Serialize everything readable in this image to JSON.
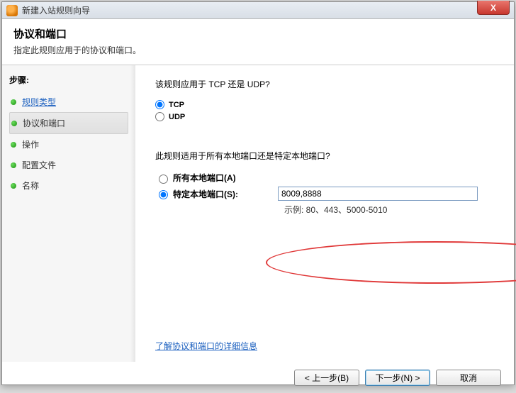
{
  "window": {
    "title": "新建入站规则向导",
    "close": "X"
  },
  "header": {
    "title": "协议和端口",
    "subtitle": "指定此规则应用于的协议和端口。"
  },
  "sidebar": {
    "steps_label": "步骤:",
    "items": [
      {
        "label": "规则类型",
        "state": "completed"
      },
      {
        "label": "协议和端口",
        "state": "current"
      },
      {
        "label": "操作",
        "state": "pending"
      },
      {
        "label": "配置文件",
        "state": "pending"
      },
      {
        "label": "名称",
        "state": "pending"
      }
    ]
  },
  "content": {
    "protocol_question": "该规则应用于 TCP 还是 UDP?",
    "protocol": {
      "tcp": "TCP",
      "udp": "UDP",
      "selected": "tcp"
    },
    "port_question": "此规则适用于所有本地端口还是特定本地端口?",
    "ports": {
      "all_label": "所有本地端口(A)",
      "specific_label": "特定本地端口(S):",
      "selected": "specific",
      "value": "8009,8888",
      "example": "示例: 80、443、5000-5010"
    },
    "learn_more": "了解协议和端口的详细信息"
  },
  "footer": {
    "back": "< 上一步(B)",
    "next": "下一步(N) >",
    "cancel": "取消"
  }
}
